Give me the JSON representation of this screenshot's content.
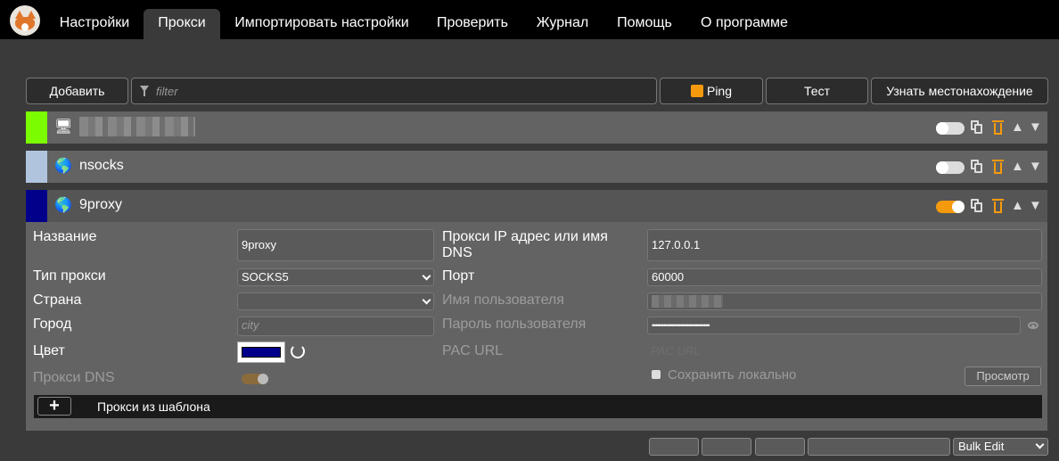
{
  "nav": {
    "tabs": [
      {
        "label": "Настройки"
      },
      {
        "label": "Прокси"
      },
      {
        "label": "Импортировать настройки"
      },
      {
        "label": "Проверить"
      },
      {
        "label": "Журнал"
      },
      {
        "label": "Помощь"
      },
      {
        "label": "О программе"
      }
    ],
    "active": "Прокси"
  },
  "toolbar": {
    "add_label": "Добавить",
    "filter_placeholder": "filter",
    "ping_label": "Ping",
    "test_label": "Тест",
    "locate_label": "Узнать местонахождение"
  },
  "proxies": [
    {
      "title": "",
      "color": "#7cfc00",
      "icon": "computer-icon",
      "enabled": false
    },
    {
      "title": "nsocks",
      "color": "#b0c4de",
      "icon": "globe-icon",
      "enabled": false
    },
    {
      "title": "9proxy",
      "color": "#02008a",
      "icon": "globe-icon",
      "enabled": true
    }
  ],
  "details": {
    "name_label": "Название",
    "name_value": "9proxy",
    "type_label": "Тип прокси",
    "type_value": "SOCKS5",
    "country_label": "Страна",
    "country_value": "",
    "city_label": "Город",
    "city_placeholder": "city",
    "color_label": "Цвет",
    "color_value": "#02008a",
    "dns_label": "Прокси DNS",
    "host_label": "Прокси IP адрес или имя DNS",
    "host_value": "127.0.0.1",
    "port_label": "Порт",
    "port_value": "60000",
    "user_label": "Имя пользователя",
    "password_label": "Пароль пользователя",
    "password_value": "••••••••••••••••••••••••••••••",
    "pac_label": "PAC URL",
    "pac_placeholder": "PAC URL",
    "save_local_label": "Сохранить локально",
    "view_label": "Просмотр",
    "template_label": "Прокси из шаблона",
    "template_add": "+"
  },
  "footer": {
    "bulk_edit": "Bulk Edit"
  },
  "colors": {
    "accent": "#f59a0c",
    "background": "#3a3a3a",
    "row": "#636363"
  }
}
